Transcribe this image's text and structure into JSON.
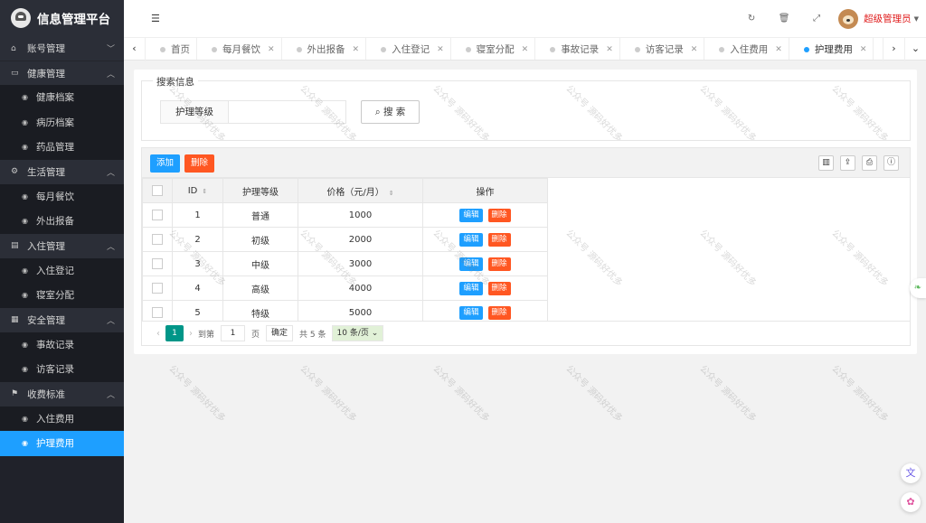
{
  "app": {
    "title": "信息管理平台"
  },
  "sidebar": {
    "groups": [
      {
        "label": "账号管理",
        "icon": "home-icon",
        "items": []
      },
      {
        "label": "健康管理",
        "icon": "window-icon",
        "items": [
          "健康档案",
          "病历档案",
          "药品管理"
        ]
      },
      {
        "label": "生活管理",
        "icon": "gears-icon",
        "items": [
          "每月餐饮",
          "外出报备"
        ]
      },
      {
        "label": "入住管理",
        "icon": "file-icon",
        "items": [
          "入住登记",
          "寝室分配"
        ]
      },
      {
        "label": "安全管理",
        "icon": "calendar-icon",
        "items": [
          "事故记录",
          "访客记录"
        ]
      },
      {
        "label": "收费标准",
        "icon": "flag-icon",
        "items": [
          "入住费用",
          "护理费用"
        ]
      }
    ],
    "active_item": "护理费用"
  },
  "topbar": {
    "user_name": "超级管理员"
  },
  "tabs": [
    "首页",
    "每月餐饮",
    "外出报备",
    "入住登记",
    "寝室分配",
    "事故记录",
    "访客记录",
    "入住费用",
    "护理费用"
  ],
  "active_tab": "护理费用",
  "search": {
    "legend": "搜索信息",
    "field_label": "护理等级",
    "field_value": "",
    "button_label": "搜 索"
  },
  "toolbar": {
    "add_label": "添加",
    "delete_label": "删除"
  },
  "table": {
    "headers": [
      "ID",
      "护理等级",
      "价格（元/月）",
      "操作"
    ],
    "rows": [
      {
        "id": "1",
        "level": "普通",
        "price": "1000"
      },
      {
        "id": "2",
        "level": "初级",
        "price": "2000"
      },
      {
        "id": "3",
        "level": "中级",
        "price": "3000"
      },
      {
        "id": "4",
        "level": "高级",
        "price": "4000"
      },
      {
        "id": "5",
        "level": "特级",
        "price": "5000"
      }
    ],
    "edit_label": "编辑",
    "delete_label": "删除"
  },
  "pager": {
    "current": "1",
    "goto_label": "到第",
    "goto_value": "1",
    "page_unit": "页",
    "confirm_label": "确定",
    "total_label": "共 5 条",
    "page_size": "10 条/页"
  },
  "watermark": "公众号 源码好优多",
  "colors": {
    "primary": "#1e9fff",
    "danger": "#ff5722",
    "pager_active": "#009688",
    "sidebar_bg": "#20222a"
  }
}
